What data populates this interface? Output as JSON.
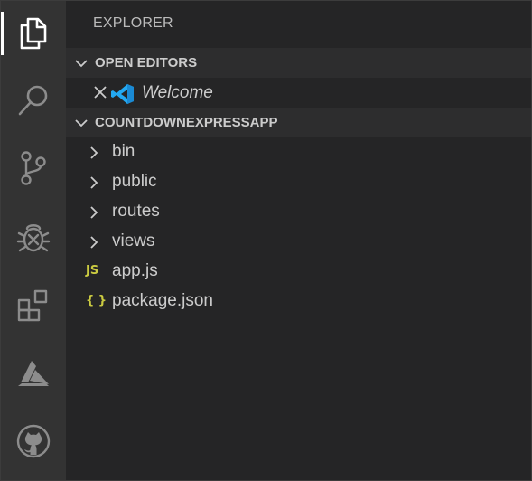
{
  "activity_bar": {
    "items": [
      {
        "icon": "files-icon",
        "label": "Explorer"
      },
      {
        "icon": "search-icon",
        "label": "Search"
      },
      {
        "icon": "source-control-icon",
        "label": "Source Control"
      },
      {
        "icon": "debug-icon",
        "label": "Run and Debug"
      },
      {
        "icon": "extensions-icon",
        "label": "Extensions"
      },
      {
        "icon": "azure-icon",
        "label": "Azure"
      },
      {
        "icon": "github-icon",
        "label": "GitHub"
      }
    ]
  },
  "sidebar": {
    "title": "EXPLORER",
    "open_editors": {
      "header": "OPEN EDITORS",
      "items": [
        {
          "label": "Welcome",
          "icon": "vscode-icon"
        }
      ]
    },
    "project": {
      "header": "COUNTDOWNEXPRESSAPP",
      "items": [
        {
          "name": "bin",
          "type": "folder"
        },
        {
          "name": "public",
          "type": "folder"
        },
        {
          "name": "routes",
          "type": "folder"
        },
        {
          "name": "views",
          "type": "folder"
        },
        {
          "name": "app.js",
          "type": "file",
          "badge": "JS"
        },
        {
          "name": "package.json",
          "type": "file",
          "badge": "{ }"
        }
      ]
    }
  },
  "colors": {
    "activity_bar_bg": "#333333",
    "sidebar_bg": "#252526",
    "icon_gray": "#8c8c8c",
    "js_yellow": "#cbcb41",
    "vscode_blue": "#23a9f2"
  }
}
